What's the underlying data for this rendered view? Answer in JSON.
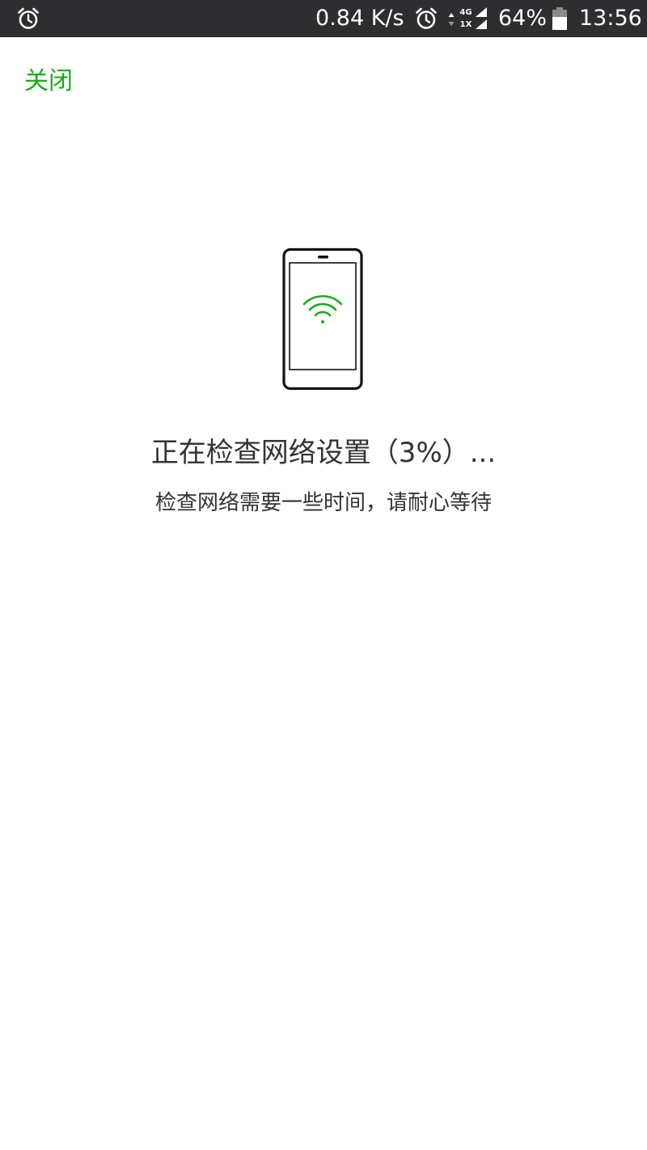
{
  "status_bar": {
    "left_icon": "alarm-clock-icon",
    "network_speed": "0.84 K/s",
    "alarm_icon": "alarm-clock-icon",
    "network_type_top": "4G",
    "network_type_bottom": "1X",
    "signal_icon": "signal-strength-icon",
    "battery_percent": "64%",
    "battery_icon": "battery-icon",
    "battery_level": 0.64,
    "time": "13:56"
  },
  "header": {
    "close_label": "关闭"
  },
  "illustration": {
    "icon": "phone-wifi-icon",
    "wifi_color": "#1aad19"
  },
  "main": {
    "title": "正在检查网络设置（3%）...",
    "subtitle": "检查网络需要一些时间，请耐心等待",
    "progress_percent": 3
  },
  "colors": {
    "accent": "#1aad19",
    "status_bar_bg": "#2e2e30",
    "text_primary": "#333333"
  }
}
